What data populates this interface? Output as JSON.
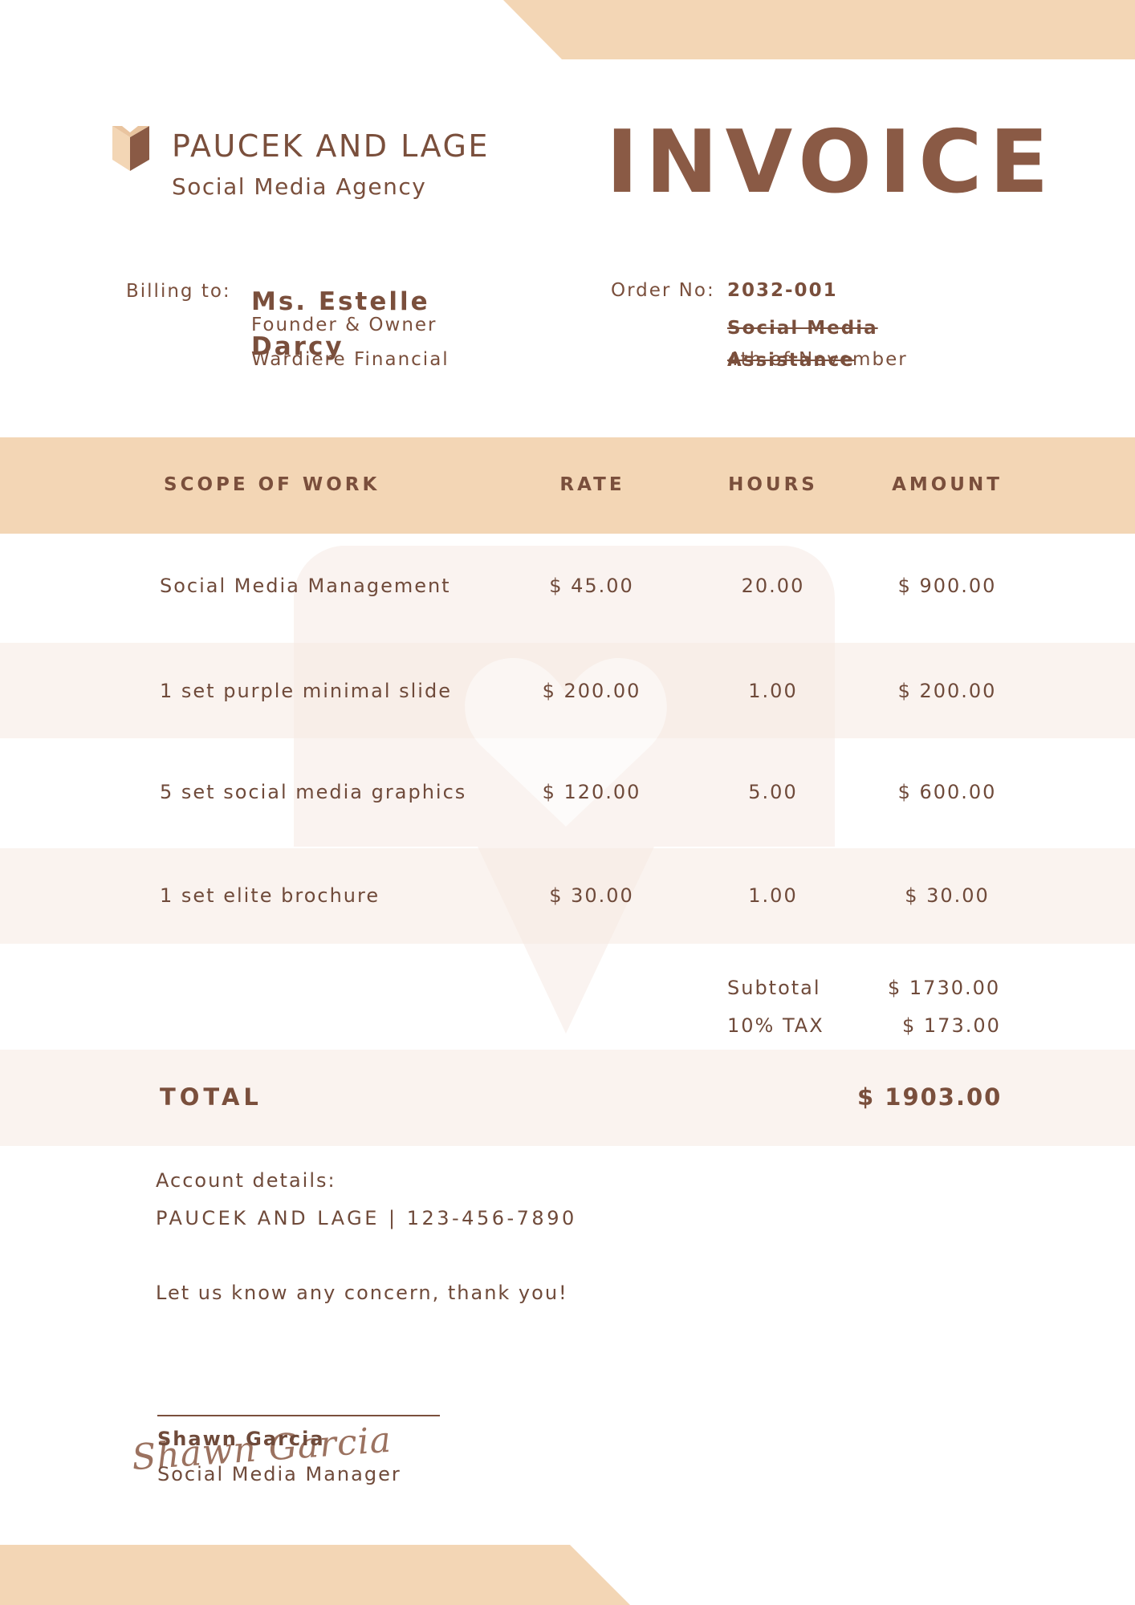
{
  "company": {
    "name": "PAUCEK AND LAGE",
    "tagline": "Social Media Agency"
  },
  "document_title": "INVOICE",
  "billing": {
    "label": "Billing to:",
    "client_name": "Ms. Estelle Darcy",
    "client_role": "Founder & Owner",
    "client_company": "Wardiere Financial"
  },
  "order": {
    "label": "Order No:",
    "number": "2032-001",
    "service": "Social Media Assistance",
    "date": "4th of November"
  },
  "table": {
    "headers": [
      "SCOPE OF WORK",
      "RATE",
      "HOURS",
      "AMOUNT"
    ],
    "rows": [
      {
        "item": "Social Media Management",
        "rate": "$ 45.00",
        "hours": "20.00",
        "amount": "$ 900.00"
      },
      {
        "item": "1 set purple minimal slide",
        "rate": "$ 200.00",
        "hours": "1.00",
        "amount": "$ 200.00"
      },
      {
        "item": "5 set social media graphics",
        "rate": "$ 120.00",
        "hours": "5.00",
        "amount": "$ 600.00"
      },
      {
        "item": "1 set elite brochure",
        "rate": "$ 30.00",
        "hours": "1.00",
        "amount": "$ 30.00"
      }
    ]
  },
  "summary": {
    "subtotal_label": "Subtotal",
    "subtotal_value": "$ 1730.00",
    "tax_label": "10% TAX",
    "tax_value": "$ 173.00",
    "total_label": "TOTAL",
    "total_value": "$ 1903.00"
  },
  "account": {
    "label": "Account details:",
    "details": "PAUCEK AND LAGE | 123-456-7890"
  },
  "closing_note": "Let us know any concern, thank you!",
  "signatory": {
    "signature_script": "Shawn Garcia",
    "name": "Shawn Garcia",
    "title": "Social Media Manager"
  },
  "colors": {
    "accent_tan": "#f3d6b5",
    "text_brown": "#7a4f3c",
    "band_light": "#faf3ef"
  },
  "icons": [
    "logo-chevron-icon",
    "watermark-heart-icon"
  ]
}
